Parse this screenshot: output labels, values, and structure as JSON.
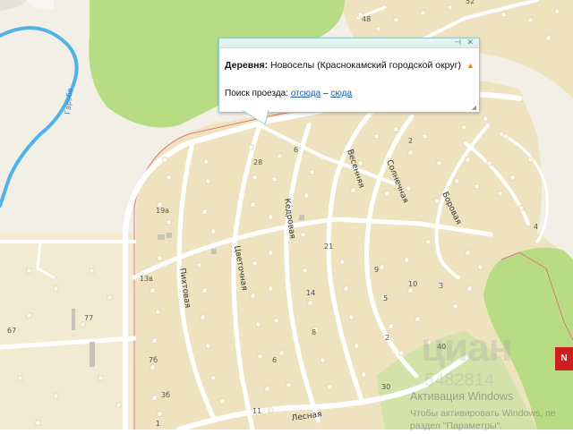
{
  "popup": {
    "title_bold": "Деревня:",
    "title_text": "Новоселы (Краснокамский городской округ)",
    "route_label": "Поиск проезда:",
    "route_from": "отсюда",
    "route_dash": "–",
    "route_to": "сюда",
    "pin_icon": "pin-icon",
    "close_icon": "close-icon",
    "warn_icon": "warning-triangle-icon"
  },
  "streets": {
    "cvetochnaya": "Цветочная",
    "kedrovaya": "Кедровая",
    "vesennyaya": "Весенняя",
    "solnechnaya": "Солнечная",
    "borovaya": "Боровая",
    "pikhtovaya": "Пихтовая",
    "lesnaya": "Лесная"
  },
  "river": "Гарьба",
  "house_numbers": {
    "n48": "48",
    "n52": "52",
    "n28": "28",
    "n6a": "6",
    "n2a": "2",
    "n19a": "19а",
    "n13v": "13в",
    "n21": "21",
    "n9": "9",
    "n14": "14",
    "n10": "10",
    "n3": "3",
    "n5": "5",
    "n8": "8",
    "n2b": "2",
    "n77": "77",
    "n67": "67",
    "n40": "40",
    "n7b": "7б",
    "n6b": "6",
    "n3b": "3б",
    "n30": "30",
    "n1": "1",
    "n11": "11",
    "n4": "4"
  },
  "watermark": {
    "brand": "циан",
    "phone": "5482814",
    "activation_title": "Активация Windows",
    "activation_line1": "Чтобы активировать Windows, пе",
    "activation_line2": "раздел \"Параметры\".",
    "red_tag": "N"
  },
  "colors": {
    "residential": "#efe2bf",
    "forest": "#b7dc84",
    "water": "#4fb3e8",
    "road": "#ffffff",
    "boundary": "#e07a7a"
  }
}
